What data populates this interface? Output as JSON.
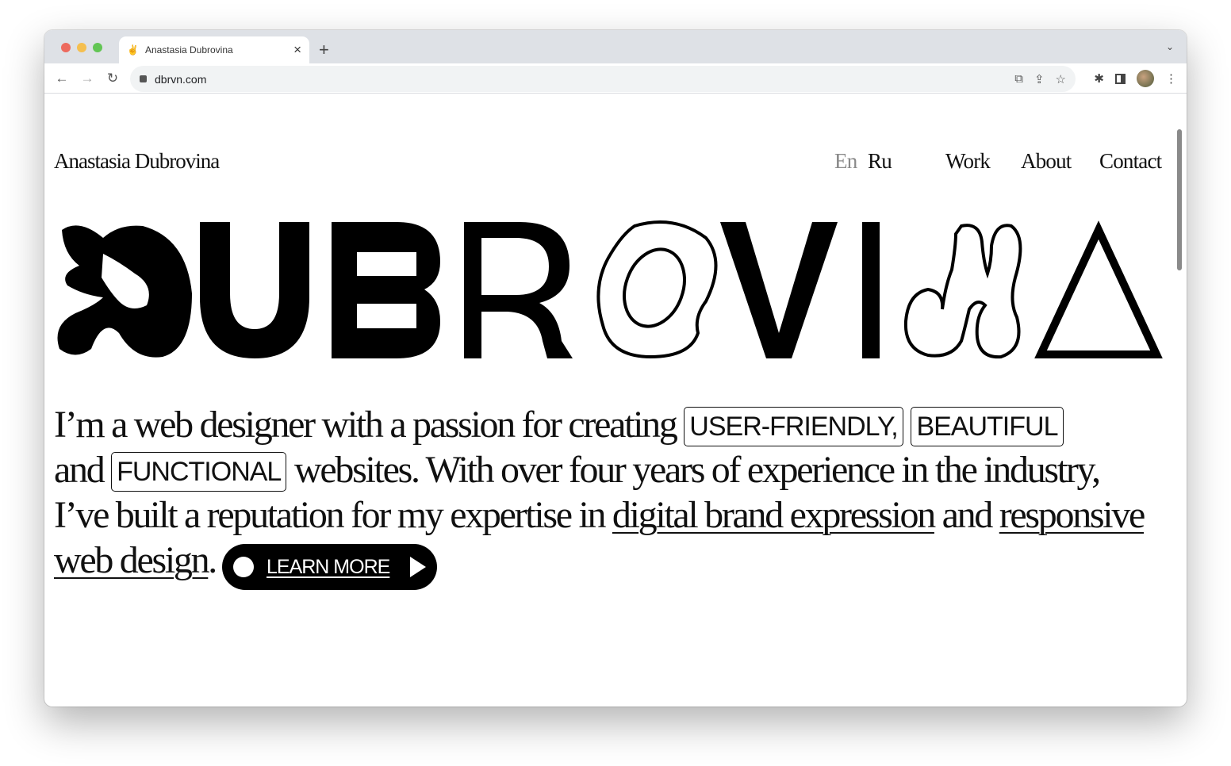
{
  "browser": {
    "tab_title": "Anastasia Dubrovina",
    "url": "dbrvn.com",
    "new_tab": "+",
    "close": "×"
  },
  "site": {
    "brand": "Anastasia Dubrovina",
    "lang": [
      {
        "label": "En",
        "active": true
      },
      {
        "label": "Ru",
        "active": false
      }
    ],
    "nav": [
      "Work",
      "About",
      "Contact"
    ],
    "logo_text": "DUBROVINA",
    "intro": {
      "t1": "I’m a web designer with a passion for creating ",
      "p1": "USER-FRIENDLY,",
      "p2": "BEAUTIFUL",
      "t2": "and ",
      "p3": "FUNCTIONAL",
      "t3": " websites. With over four years of experience in the industry, I’ve built a reputation for my expertise in ",
      "l1": "digital brand expression",
      "t4": " and ",
      "l2": "responsive web design",
      "t5": ".",
      "cta": "LEARN MORE"
    }
  },
  "colors": {
    "text": "#111111",
    "muted": "#8a8a8a",
    "button": "#000000"
  }
}
